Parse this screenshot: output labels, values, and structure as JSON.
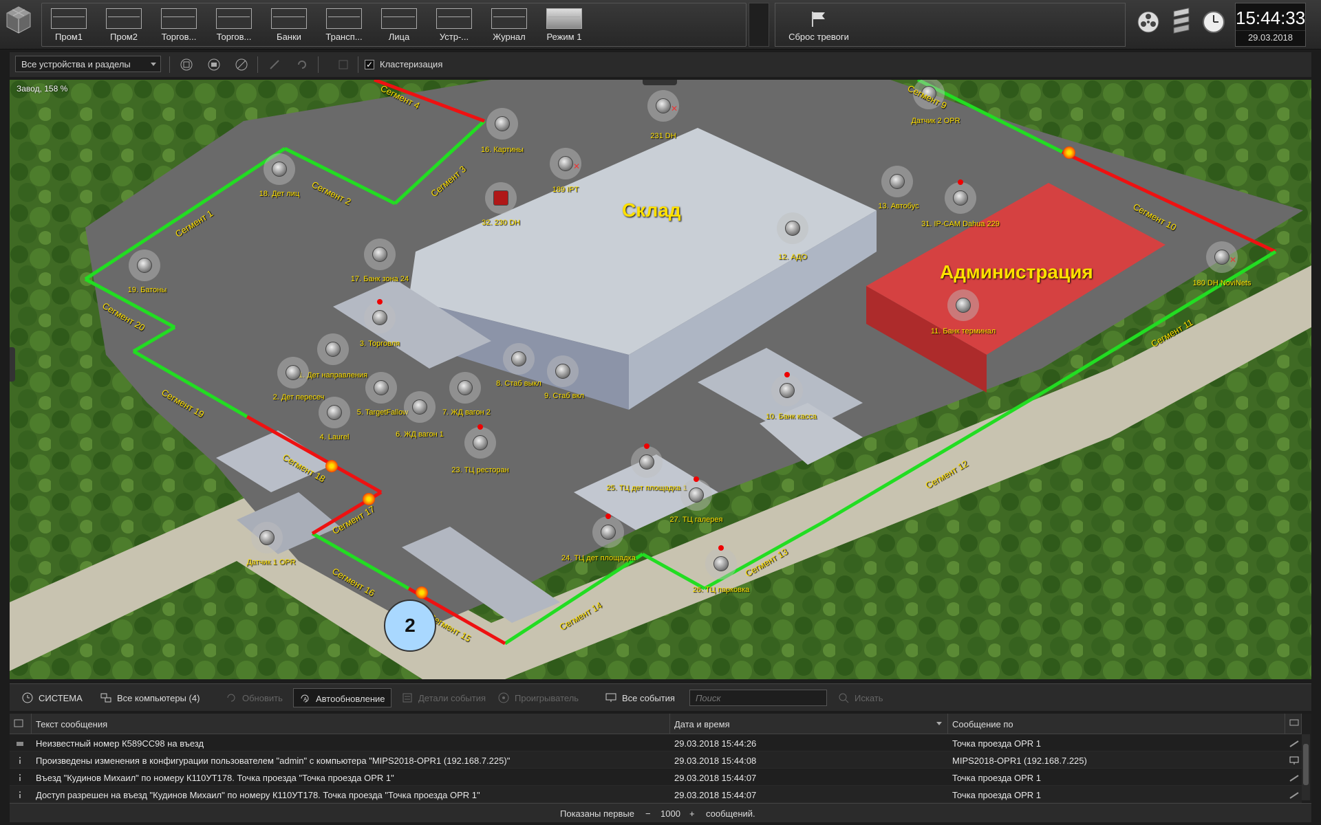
{
  "toolbar": {
    "layouts": [
      {
        "label": "Пром1"
      },
      {
        "label": "Пром2"
      },
      {
        "label": "Торгов..."
      },
      {
        "label": "Торгов..."
      },
      {
        "label": "Банки"
      },
      {
        "label": "Трансп..."
      },
      {
        "label": "Лица"
      },
      {
        "label": "Устр-..."
      },
      {
        "label": "Журнал"
      },
      {
        "label": "Режим 1"
      }
    ],
    "active_layout": "Режим 1",
    "alarm_reset_label": "Сброс тревоги",
    "right_icons": [
      "video-reel-icon",
      "servers-icon",
      "clock-icon"
    ]
  },
  "clock": {
    "time": "15:44:33",
    "date": "29.03.2018"
  },
  "filter_bar": {
    "scope_selected": "Все устройства и разделы",
    "clustering_checked": true,
    "clustering_label": "Кластеризация",
    "icons": [
      "stop-icon",
      "stop-icon",
      "disable-icon",
      "edit-icon",
      "rotate-icon",
      "arm-icon"
    ]
  },
  "map": {
    "zoom_text": "Завод, 158 %",
    "zones": {
      "warehouse": "Склад",
      "admin": "Администрация"
    },
    "cluster_count": "2",
    "cameras": [
      {
        "label": "16. Картины",
        "alert": false,
        "error": false
      },
      {
        "label": "231 DH",
        "alert": false,
        "error": true
      },
      {
        "label": "Датчик 2 OPR",
        "alert": false,
        "error": false
      },
      {
        "label": "18. Дет лиц",
        "alert": false,
        "error": false
      },
      {
        "label": "189 IPT",
        "alert": false,
        "error": true
      },
      {
        "label": "32. 230 DH",
        "alert": false,
        "error": false
      },
      {
        "label": "13. Автобус",
        "alert": false,
        "error": false
      },
      {
        "label": "31. IP-CAM Dahua 229",
        "alert": true,
        "error": false
      },
      {
        "label": "12. АДО",
        "alert": false,
        "error": false
      },
      {
        "label": "19. Батоны",
        "alert": false,
        "error": false
      },
      {
        "label": "17. Банк зона 24",
        "alert": false,
        "error": false
      },
      {
        "label": "180 DH NoviNets",
        "alert": false,
        "error": true
      },
      {
        "label": "3. Торговля",
        "alert": true,
        "error": false
      },
      {
        "label": "11. Банк терминал",
        "alert": false,
        "error": false
      },
      {
        "label": "1. Дет направления",
        "alert": false,
        "error": false
      },
      {
        "label": "2. Дет пересеч",
        "alert": false,
        "error": false
      },
      {
        "label": "8. Стаб выкл",
        "alert": false,
        "error": false
      },
      {
        "label": "9. Стаб вкл",
        "alert": false,
        "error": false
      },
      {
        "label": "5. TargetFallow",
        "alert": false,
        "error": false
      },
      {
        "label": "7. ЖД вагон 2",
        "alert": false,
        "error": false
      },
      {
        "label": "10. Банк касса",
        "alert": true,
        "error": false
      },
      {
        "label": "4. Laurel",
        "alert": false,
        "error": false
      },
      {
        "label": "6. ЖД вагон 1",
        "alert": false,
        "error": false
      },
      {
        "label": "23. ТЦ ресторан",
        "alert": true,
        "error": false
      },
      {
        "label": "25. ТЦ дет площадка 1",
        "alert": true,
        "error": false
      },
      {
        "label": "27. ТЦ галерея",
        "alert": true,
        "error": false
      },
      {
        "label": "Датчик 1 OPR",
        "alert": false,
        "error": false
      },
      {
        "label": "24. ТЦ дет площадка",
        "alert": true,
        "error": false
      },
      {
        "label": "26. ТЦ парковка",
        "alert": true,
        "error": false
      }
    ],
    "segments": [
      "Сегмент 1",
      "Сегмент 2",
      "Сегмент 3",
      "Сегмент 4",
      "Сегмент 9",
      "Сегмент 10",
      "Сегмент 11",
      "Сегмент 12",
      "Сегмент 13",
      "Сегмент 14",
      "Сегмент 15",
      "Сегмент 16",
      "Сегмент 17",
      "Сегмент 18",
      "Сегмент 19",
      "Сегмент 20"
    ]
  },
  "events_bar": {
    "system_label": "СИСТЕМА",
    "computers_label": "Все компьютеры (4)",
    "refresh_label": "Обновить",
    "autorefresh_label": "Автообновление",
    "details_label": "Детали события",
    "player_label": "Проигрыватель",
    "all_events_label": "Все события",
    "search_placeholder": "Поиск",
    "search_button": "Искать"
  },
  "events_table": {
    "columns": [
      "Текст сообщения",
      "Дата и время",
      "Сообщение по"
    ],
    "rows": [
      {
        "text": "Неизвестный номер К589СС98 на въезд",
        "datetime": "29.03.2018 15:44:26",
        "source": "Точка проезда OPR 1"
      },
      {
        "text": "Произведены изменения в конфигурации пользователем \"admin\" с компьютера \"MIPS2018-OPR1 (192.168.7.225)\"",
        "datetime": "29.03.2018 15:44:08",
        "source": "MIPS2018-OPR1 (192.168.7.225)"
      },
      {
        "text": "Въезд \"Кудинов Михаил\" по номеру К110УТ178. Точка проезда \"Точка проезда OPR 1\"",
        "datetime": "29.03.2018 15:44:07",
        "source": "Точка проезда OPR 1"
      },
      {
        "text": "Доступ разрешен на въезд \"Кудинов Михаил\" по номеру К110УТ178. Точка проезда \"Точка проезда OPR 1\"",
        "datetime": "29.03.2018 15:44:07",
        "source": "Точка проезда OPR 1"
      }
    ]
  },
  "status_bar": {
    "prefix": "Показаны первые",
    "minus": "−",
    "count": "1000",
    "plus": "+",
    "suffix": "сообщений."
  }
}
